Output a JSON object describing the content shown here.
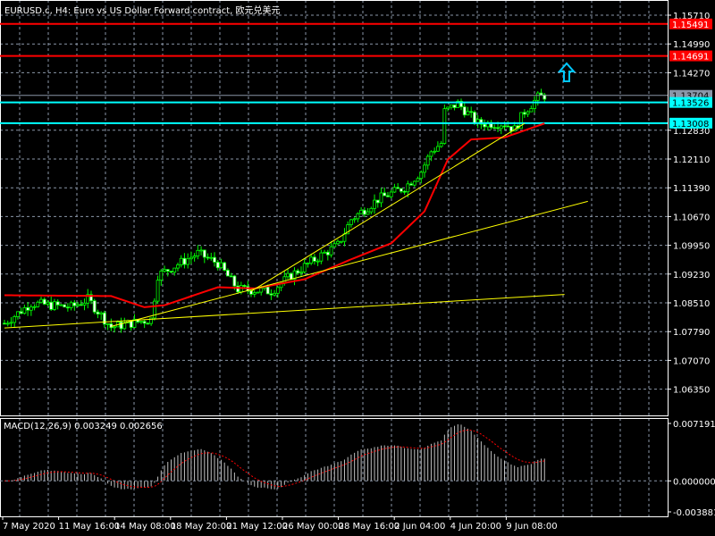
{
  "title": "EURUSD.c, H4:  Euro vs US Dollar Forward contract, 欧元兑美元",
  "colors": {
    "bg": "#000000",
    "grid": "#8a96a8",
    "candle": "#00ff00",
    "ma": "#ff0000",
    "trend": "#ffff00",
    "level_red": "#ff0000",
    "level_cyan": "#00ffff",
    "bid": "#8a96a8",
    "macd_hist": "#c0c0c0",
    "macd_signal": "#ff0000"
  },
  "price_axis": [
    "1.15710",
    "1.14990",
    "1.14270",
    "1.12830",
    "1.12110",
    "1.11390",
    "1.10670",
    "1.09950",
    "1.09230",
    "1.08510",
    "1.07790",
    "1.07070",
    "1.06350"
  ],
  "levels": [
    {
      "label": "1.15491",
      "price": 1.15491,
      "color": "#ff0000",
      "text": "#ffffff"
    },
    {
      "label": "1.14691",
      "price": 1.14691,
      "color": "#ff0000",
      "text": "#ffffff"
    },
    {
      "label": "1.13704",
      "price": 1.13704,
      "color": "#8a96a8",
      "text": "#000000"
    },
    {
      "label": "1.13526",
      "price": 1.13526,
      "color": "#00ffff",
      "text": "#000000"
    },
    {
      "label": "1.13008",
      "price": 1.13008,
      "color": "#00ffff",
      "text": "#000000"
    }
  ],
  "arrow": {
    "icon": "up-arrow-icon",
    "color": "#00c8ff"
  },
  "macd": {
    "label": "MACD(12,26,9) 0.003249 0.002656",
    "axis": [
      "0.007191",
      "0.000000",
      "-0.003881"
    ],
    "max": 0.007191,
    "min": -0.003881
  },
  "time_axis": [
    "7 May 2020",
    "11 May 16:00",
    "14 May 08:00",
    "18 May 20:00",
    "21 May 12:00",
    "26 May 00:00",
    "28 May 16:00",
    "2 Jun 04:00",
    "4 Jun 20:00",
    "9 Jun 08:00"
  ],
  "chart_data": {
    "type": "candlestick",
    "symbol": "EURUSD.c",
    "timeframe": "H4",
    "ylim": [
      1.06,
      1.161
    ],
    "close_waypoints": [
      [
        0,
        1.08
      ],
      [
        8,
        1.085
      ],
      [
        20,
        1.084
      ],
      [
        25,
        1.086
      ],
      [
        32,
        1.079
      ],
      [
        44,
        1.081
      ],
      [
        46,
        1.092
      ],
      [
        58,
        1.0975
      ],
      [
        64,
        1.095
      ],
      [
        70,
        1.0885
      ],
      [
        80,
        1.088
      ],
      [
        86,
        1.092
      ],
      [
        94,
        1.0965
      ],
      [
        100,
        1.0995
      ],
      [
        104,
        1.106
      ],
      [
        112,
        1.111
      ],
      [
        120,
        1.114
      ],
      [
        125,
        1.118
      ],
      [
        128,
        1.123
      ],
      [
        131,
        1.125
      ],
      [
        132,
        1.133
      ],
      [
        136,
        1.135
      ],
      [
        142,
        1.13
      ],
      [
        150,
        1.13
      ],
      [
        153,
        1.1285
      ],
      [
        156,
        1.133
      ],
      [
        160,
        1.1365
      ],
      [
        162,
        1.137
      ]
    ],
    "ma_waypoints": [
      [
        0,
        1.087
      ],
      [
        32,
        1.0868
      ],
      [
        42,
        1.084
      ],
      [
        48,
        1.0845
      ],
      [
        64,
        1.089
      ],
      [
        75,
        1.0887
      ],
      [
        90,
        1.091
      ],
      [
        104,
        1.096
      ],
      [
        116,
        1.1
      ],
      [
        126,
        1.108
      ],
      [
        133,
        1.121
      ],
      [
        140,
        1.126
      ],
      [
        150,
        1.1265
      ],
      [
        162,
        1.13
      ]
    ],
    "trendlines": [
      [
        [
          0,
          1.0788
        ],
        [
          168,
          1.0872
        ]
      ],
      [
        [
          32,
          1.0792
        ],
        [
          175,
          1.1105
        ]
      ],
      [
        [
          74,
          1.088
        ],
        [
          156,
          1.13
        ]
      ]
    ]
  }
}
